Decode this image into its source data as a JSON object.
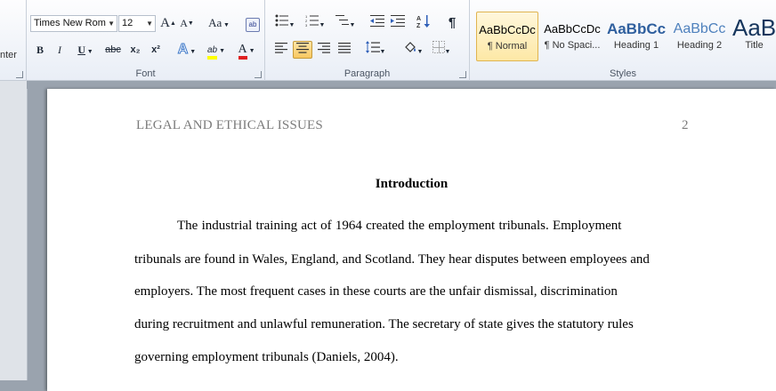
{
  "ribbon": {
    "clipboard": {
      "partial_label": "nter"
    },
    "font": {
      "group_label": "Font",
      "font_name": "Times New Rom",
      "font_size": "12",
      "grow_label": "A",
      "shrink_label": "A",
      "change_case_label": "Aa",
      "bold": "B",
      "italic": "I",
      "underline": "U",
      "strikethrough": "abc",
      "subscript": "x₂",
      "superscript": "x²",
      "effects_label": "A",
      "highlight_label": "ab",
      "font_color_label": "A",
      "highlight_color": "#ffff00",
      "font_color": "#e02020"
    },
    "paragraph": {
      "group_label": "Paragraph",
      "show_marks": "¶"
    },
    "styles": {
      "group_label": "Styles",
      "items": [
        {
          "sample": "AaBbCcDc",
          "name": "¶ Normal",
          "active": true
        },
        {
          "sample": "AaBbCcDc",
          "name": "¶ No Spaci..."
        },
        {
          "sample": "AaBbCc",
          "name": "Heading 1"
        },
        {
          "sample": "AaBbCc",
          "name": "Heading 2"
        },
        {
          "sample": "AaB",
          "name": "Title"
        }
      ]
    }
  },
  "document": {
    "running_head": "LEGAL AND ETHICAL ISSUES",
    "page_number": "2",
    "title": "Introduction",
    "lines": [
      "The industrial training act of 1964 created the employment tribunals. Employment",
      "tribunals are found in Wales, England, and Scotland. They hear disputes between employees and",
      "employers. The most frequent cases in these courts are the unfair dismissal, discrimination",
      "during recruitment and unlawful remuneration. The secretary of state gives the statutory rules",
      "governing employment tribunals (Daniels, 2004)."
    ]
  }
}
